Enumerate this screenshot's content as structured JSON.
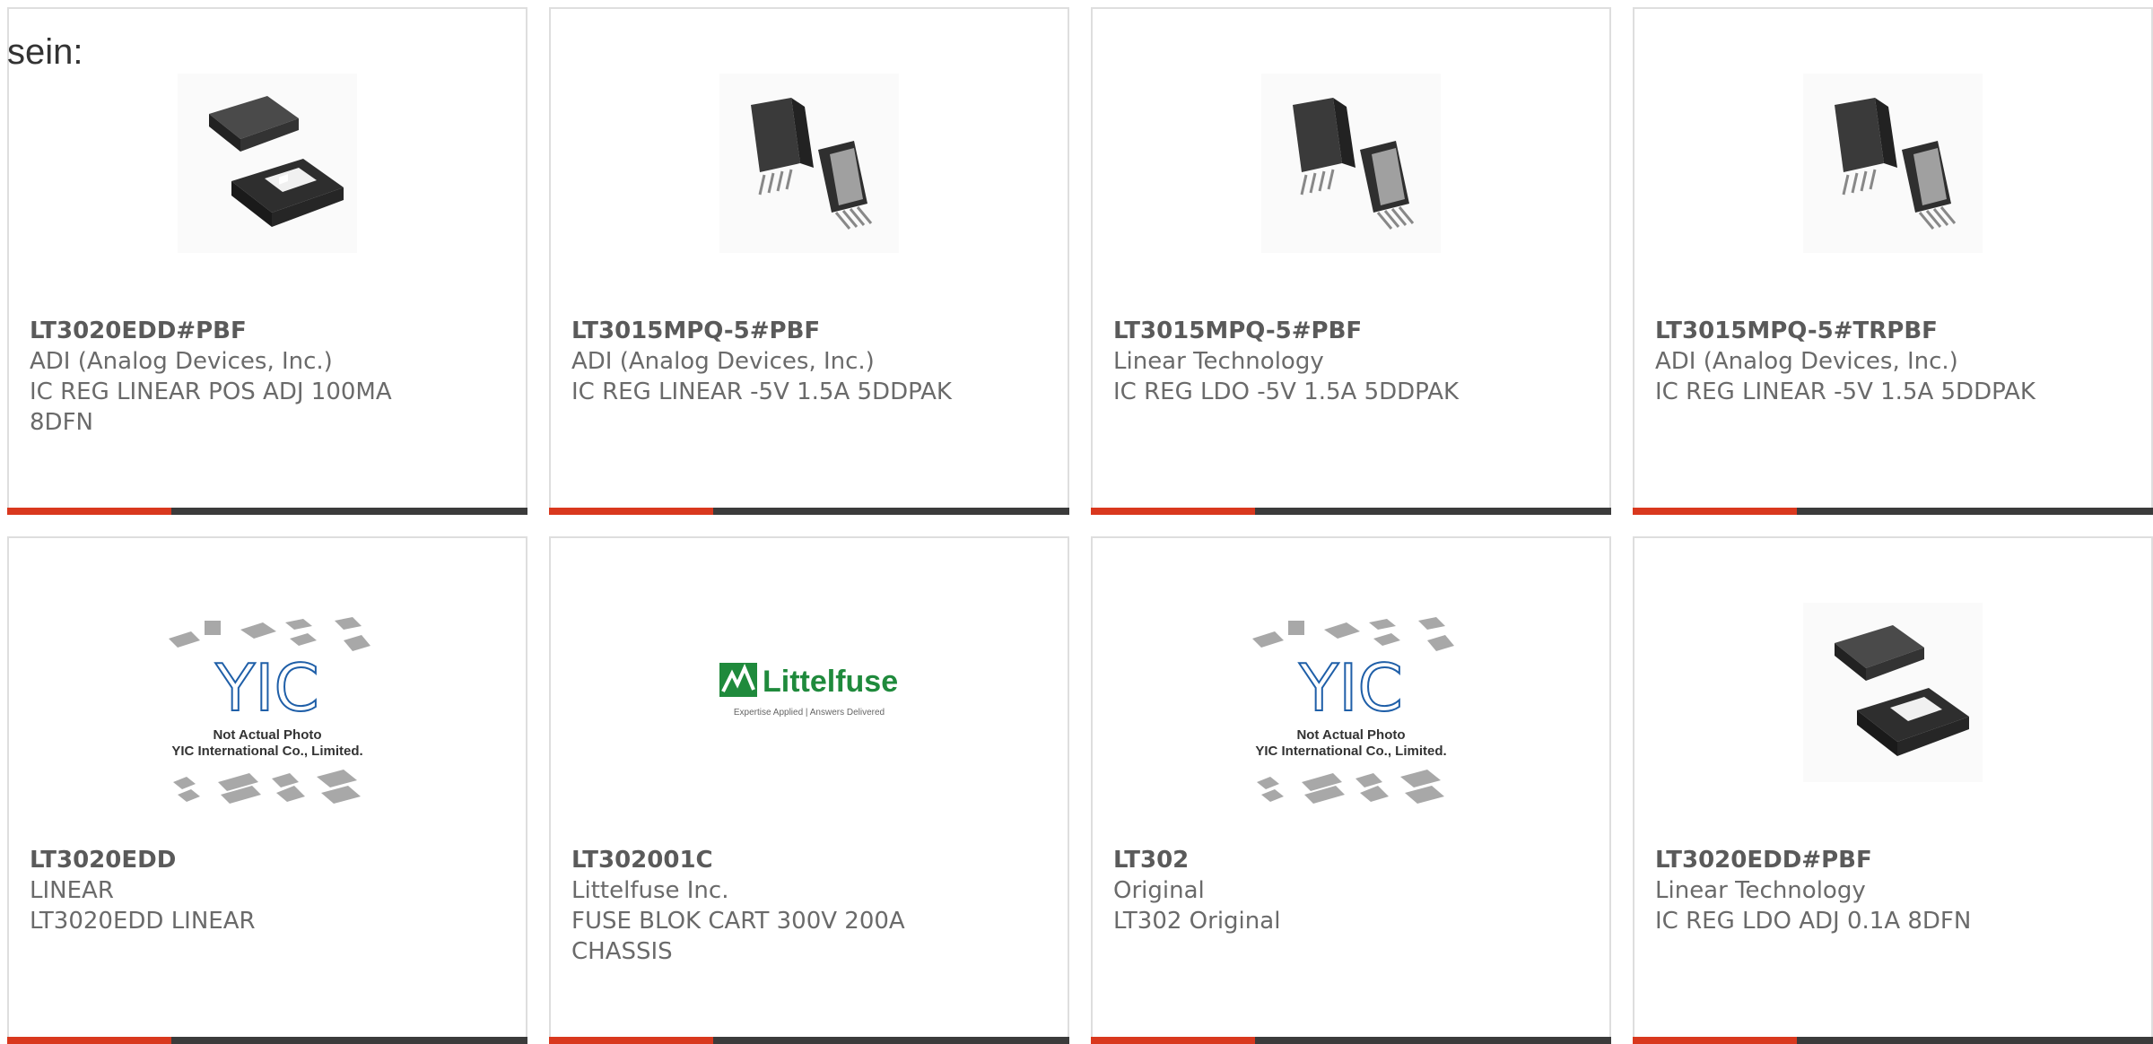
{
  "intro_text": "sein:",
  "cards": [
    {
      "part": "LT3020EDD#PBF",
      "manufacturer": "ADI (Analog Devices, Inc.)",
      "description": "IC REG LINEAR POS ADJ 100MA 8DFN",
      "image": "dfn-chip-icon"
    },
    {
      "part": "LT3015MPQ-5#PBF",
      "manufacturer": "ADI (Analog Devices, Inc.)",
      "description": "IC REG LINEAR -5V 1.5A 5DDPAK",
      "image": "ddpak-chip-icon"
    },
    {
      "part": "LT3015MPQ-5#PBF",
      "manufacturer": "Linear Technology",
      "description": "IC REG LDO -5V 1.5A 5DDPAK",
      "image": "ddpak-chip-icon"
    },
    {
      "part": "LT3015MPQ-5#TRPBF",
      "manufacturer": "ADI (Analog Devices, Inc.)",
      "description": "IC REG LINEAR -5V 1.5A 5DDPAK",
      "image": "ddpak-chip-icon"
    },
    {
      "part": "LT3020EDD",
      "manufacturer": "LINEAR",
      "description": "LT3020EDD LINEAR",
      "image": "yic-placeholder-image",
      "image_caption_1": "Not Actual Photo",
      "image_caption_2": "YIC International Co., Limited.",
      "logo_text": "YIC"
    },
    {
      "part": "LT302001C",
      "manufacturer": "Littelfuse Inc.",
      "description": "FUSE BLOK CART 300V 200A CHASSIS",
      "image": "littelfuse-logo",
      "logo_text": "Littelfuse",
      "logo_tagline": "Expertise Applied | Answers Delivered"
    },
    {
      "part": "LT302",
      "manufacturer": "Original",
      "description": "LT302 Original",
      "image": "yic-placeholder-image",
      "image_caption_1": "Not Actual Photo",
      "image_caption_2": "YIC International Co., Limited.",
      "logo_text": "YIC"
    },
    {
      "part": "LT3020EDD#PBF",
      "manufacturer": "Linear Technology",
      "description": "IC REG LDO ADJ 0.1A 8DFN",
      "image": "dfn-chip-icon"
    }
  ],
  "colors": {
    "accent": "#d9381e",
    "bar": "#3b3b3b",
    "border": "#dedede",
    "text": "#6a6a6a"
  }
}
